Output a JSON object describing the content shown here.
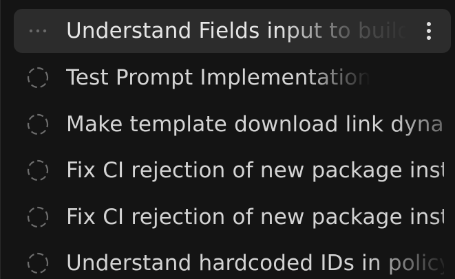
{
  "tasks": [
    {
      "title": "Understand Fields input to build",
      "status": "in-progress",
      "active": true
    },
    {
      "title": "Test Prompt Implementation",
      "status": "pending"
    },
    {
      "title": "Make template download link dynamic",
      "status": "pending"
    },
    {
      "title": "Fix CI rejection of new package installation",
      "status": "pending"
    },
    {
      "title": "Fix CI rejection of new package installation",
      "status": "pending"
    },
    {
      "title": "Understand hardcoded IDs in policy",
      "status": "pending"
    }
  ],
  "colors": {
    "background": "#141414",
    "active_row": "#2c2c2c",
    "text": "#e6e6e6",
    "icon": "#6e6e6e"
  },
  "icons": {
    "pending": "dashed-circle-icon",
    "in_progress": "ellipsis-icon",
    "menu": "more-vertical-icon"
  }
}
